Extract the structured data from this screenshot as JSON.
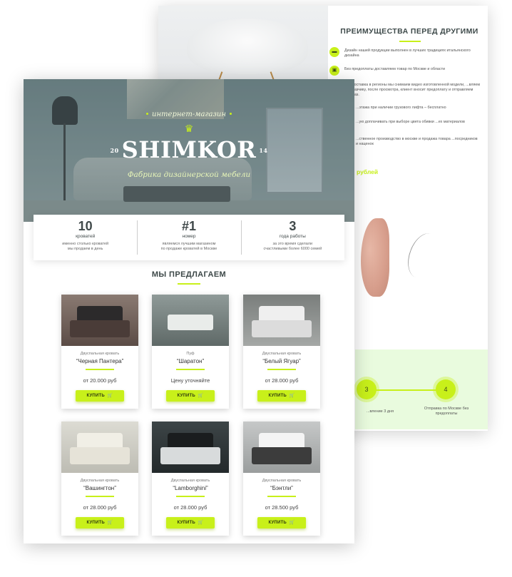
{
  "back_page": {
    "advantages_title": "ПРЕИМУЩЕСТВА ПЕРЕД ДРУГИМИ",
    "advantages": [
      {
        "icon": "sofa-icon",
        "text": "Дизайн нашей продукции выполнен в лучших традициях итальянского дизайна"
      },
      {
        "icon": "truck-icon",
        "text": "Без предоплаты доставляем товар по Москве и области"
      },
      {
        "icon": "",
        "text": "...доставка в регионы мы снимаем видео изготовленной модели, ...вляем заказчику, после просмотра, клиент вносит предоплату и отправляем заказ."
      },
      {
        "icon": "",
        "text": "...этажа при наличии грузового лифта – бесплатно"
      },
      {
        "icon": "",
        "text": "...ую доплачивать при выборе цвета обивки ...ех материалов"
      },
      {
        "icon": "",
        "text": "...ственное производство в москве и продажа товара ...посредников и наценок"
      }
    ],
    "price_teaser": "рублей",
    "steps": [
      {
        "number": "3",
        "caption": "...вление 3 дня"
      },
      {
        "number": "4",
        "caption": "Отправка по Москве без предоплаты"
      }
    ]
  },
  "hero": {
    "subtitle": "интернет-магазин",
    "brand": "SHIMKOR",
    "year_left": "20",
    "year_right": "14",
    "tagline": "Фабрика дизайнерской мебели"
  },
  "stats": [
    {
      "number": "10",
      "label": "кроватей",
      "desc_line1": "именно столько кроватей",
      "desc_line2": "мы продаем в день"
    },
    {
      "number": "#1",
      "label": "номер",
      "desc_line1": "являемся лучшим магазином",
      "desc_line2": "по продаже кроватей в Москве"
    },
    {
      "number": "3",
      "label": "года работы",
      "desc_line1": "за это время сделали",
      "desc_line2": "счастливыми более 6000 семей"
    }
  ],
  "offer_title": "МЫ ПРЕДЛАГАЕМ",
  "buy_label": "КУПИТЬ",
  "products": [
    {
      "category": "Двуспальная кровать",
      "name": "“Черная Пантера”",
      "price": "от 20.000 руб"
    },
    {
      "category": "Пуф",
      "name": "“Шаратон”",
      "price": "Цену уточняйте"
    },
    {
      "category": "Двуспальная кровать",
      "name": "“Белый Ягуар”",
      "price": "от 28.000 руб"
    },
    {
      "category": "Двуспальная кровать",
      "name": "“Вашингтон”",
      "price": "от 28.000 руб"
    },
    {
      "category": "Двуспальная кровать",
      "name": "“Lamborghini”",
      "price": "от 28.000 руб"
    },
    {
      "category": "Двуспальная кровать",
      "name": "“Бэнтли”",
      "price": "от 28.500 руб"
    }
  ],
  "colors": {
    "accent": "#c8f01a",
    "text_dark": "#3d4848",
    "steps_band": "#e9fbde"
  }
}
